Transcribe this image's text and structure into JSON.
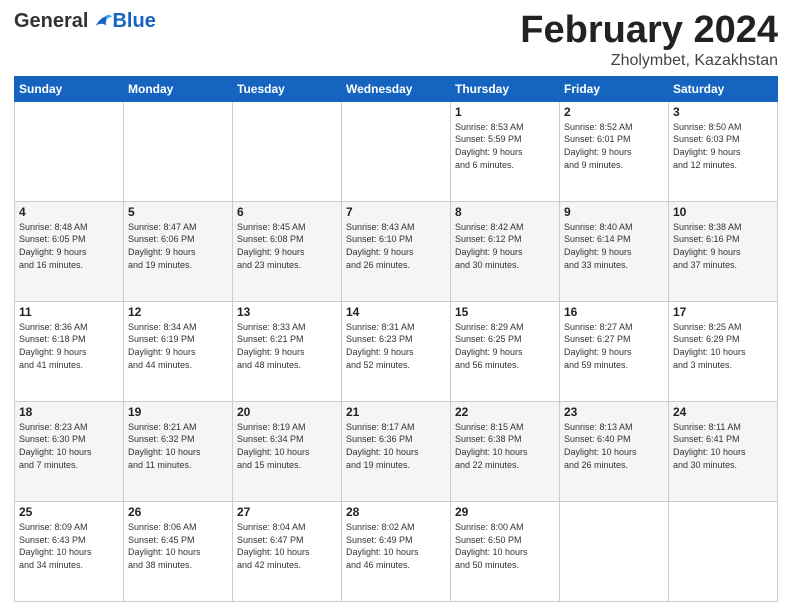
{
  "header": {
    "logo_general": "General",
    "logo_blue": "Blue",
    "month_title": "February 2024",
    "location": "Zholymbet, Kazakhstan"
  },
  "days_of_week": [
    "Sunday",
    "Monday",
    "Tuesday",
    "Wednesday",
    "Thursday",
    "Friday",
    "Saturday"
  ],
  "weeks": [
    [
      {
        "day": "",
        "info": ""
      },
      {
        "day": "",
        "info": ""
      },
      {
        "day": "",
        "info": ""
      },
      {
        "day": "",
        "info": ""
      },
      {
        "day": "1",
        "info": "Sunrise: 8:53 AM\nSunset: 5:59 PM\nDaylight: 9 hours\nand 6 minutes."
      },
      {
        "day": "2",
        "info": "Sunrise: 8:52 AM\nSunset: 6:01 PM\nDaylight: 9 hours\nand 9 minutes."
      },
      {
        "day": "3",
        "info": "Sunrise: 8:50 AM\nSunset: 6:03 PM\nDaylight: 9 hours\nand 12 minutes."
      }
    ],
    [
      {
        "day": "4",
        "info": "Sunrise: 8:48 AM\nSunset: 6:05 PM\nDaylight: 9 hours\nand 16 minutes."
      },
      {
        "day": "5",
        "info": "Sunrise: 8:47 AM\nSunset: 6:06 PM\nDaylight: 9 hours\nand 19 minutes."
      },
      {
        "day": "6",
        "info": "Sunrise: 8:45 AM\nSunset: 6:08 PM\nDaylight: 9 hours\nand 23 minutes."
      },
      {
        "day": "7",
        "info": "Sunrise: 8:43 AM\nSunset: 6:10 PM\nDaylight: 9 hours\nand 26 minutes."
      },
      {
        "day": "8",
        "info": "Sunrise: 8:42 AM\nSunset: 6:12 PM\nDaylight: 9 hours\nand 30 minutes."
      },
      {
        "day": "9",
        "info": "Sunrise: 8:40 AM\nSunset: 6:14 PM\nDaylight: 9 hours\nand 33 minutes."
      },
      {
        "day": "10",
        "info": "Sunrise: 8:38 AM\nSunset: 6:16 PM\nDaylight: 9 hours\nand 37 minutes."
      }
    ],
    [
      {
        "day": "11",
        "info": "Sunrise: 8:36 AM\nSunset: 6:18 PM\nDaylight: 9 hours\nand 41 minutes."
      },
      {
        "day": "12",
        "info": "Sunrise: 8:34 AM\nSunset: 6:19 PM\nDaylight: 9 hours\nand 44 minutes."
      },
      {
        "day": "13",
        "info": "Sunrise: 8:33 AM\nSunset: 6:21 PM\nDaylight: 9 hours\nand 48 minutes."
      },
      {
        "day": "14",
        "info": "Sunrise: 8:31 AM\nSunset: 6:23 PM\nDaylight: 9 hours\nand 52 minutes."
      },
      {
        "day": "15",
        "info": "Sunrise: 8:29 AM\nSunset: 6:25 PM\nDaylight: 9 hours\nand 56 minutes."
      },
      {
        "day": "16",
        "info": "Sunrise: 8:27 AM\nSunset: 6:27 PM\nDaylight: 9 hours\nand 59 minutes."
      },
      {
        "day": "17",
        "info": "Sunrise: 8:25 AM\nSunset: 6:29 PM\nDaylight: 10 hours\nand 3 minutes."
      }
    ],
    [
      {
        "day": "18",
        "info": "Sunrise: 8:23 AM\nSunset: 6:30 PM\nDaylight: 10 hours\nand 7 minutes."
      },
      {
        "day": "19",
        "info": "Sunrise: 8:21 AM\nSunset: 6:32 PM\nDaylight: 10 hours\nand 11 minutes."
      },
      {
        "day": "20",
        "info": "Sunrise: 8:19 AM\nSunset: 6:34 PM\nDaylight: 10 hours\nand 15 minutes."
      },
      {
        "day": "21",
        "info": "Sunrise: 8:17 AM\nSunset: 6:36 PM\nDaylight: 10 hours\nand 19 minutes."
      },
      {
        "day": "22",
        "info": "Sunrise: 8:15 AM\nSunset: 6:38 PM\nDaylight: 10 hours\nand 22 minutes."
      },
      {
        "day": "23",
        "info": "Sunrise: 8:13 AM\nSunset: 6:40 PM\nDaylight: 10 hours\nand 26 minutes."
      },
      {
        "day": "24",
        "info": "Sunrise: 8:11 AM\nSunset: 6:41 PM\nDaylight: 10 hours\nand 30 minutes."
      }
    ],
    [
      {
        "day": "25",
        "info": "Sunrise: 8:09 AM\nSunset: 6:43 PM\nDaylight: 10 hours\nand 34 minutes."
      },
      {
        "day": "26",
        "info": "Sunrise: 8:06 AM\nSunset: 6:45 PM\nDaylight: 10 hours\nand 38 minutes."
      },
      {
        "day": "27",
        "info": "Sunrise: 8:04 AM\nSunset: 6:47 PM\nDaylight: 10 hours\nand 42 minutes."
      },
      {
        "day": "28",
        "info": "Sunrise: 8:02 AM\nSunset: 6:49 PM\nDaylight: 10 hours\nand 46 minutes."
      },
      {
        "day": "29",
        "info": "Sunrise: 8:00 AM\nSunset: 6:50 PM\nDaylight: 10 hours\nand 50 minutes."
      },
      {
        "day": "",
        "info": ""
      },
      {
        "day": "",
        "info": ""
      }
    ]
  ]
}
